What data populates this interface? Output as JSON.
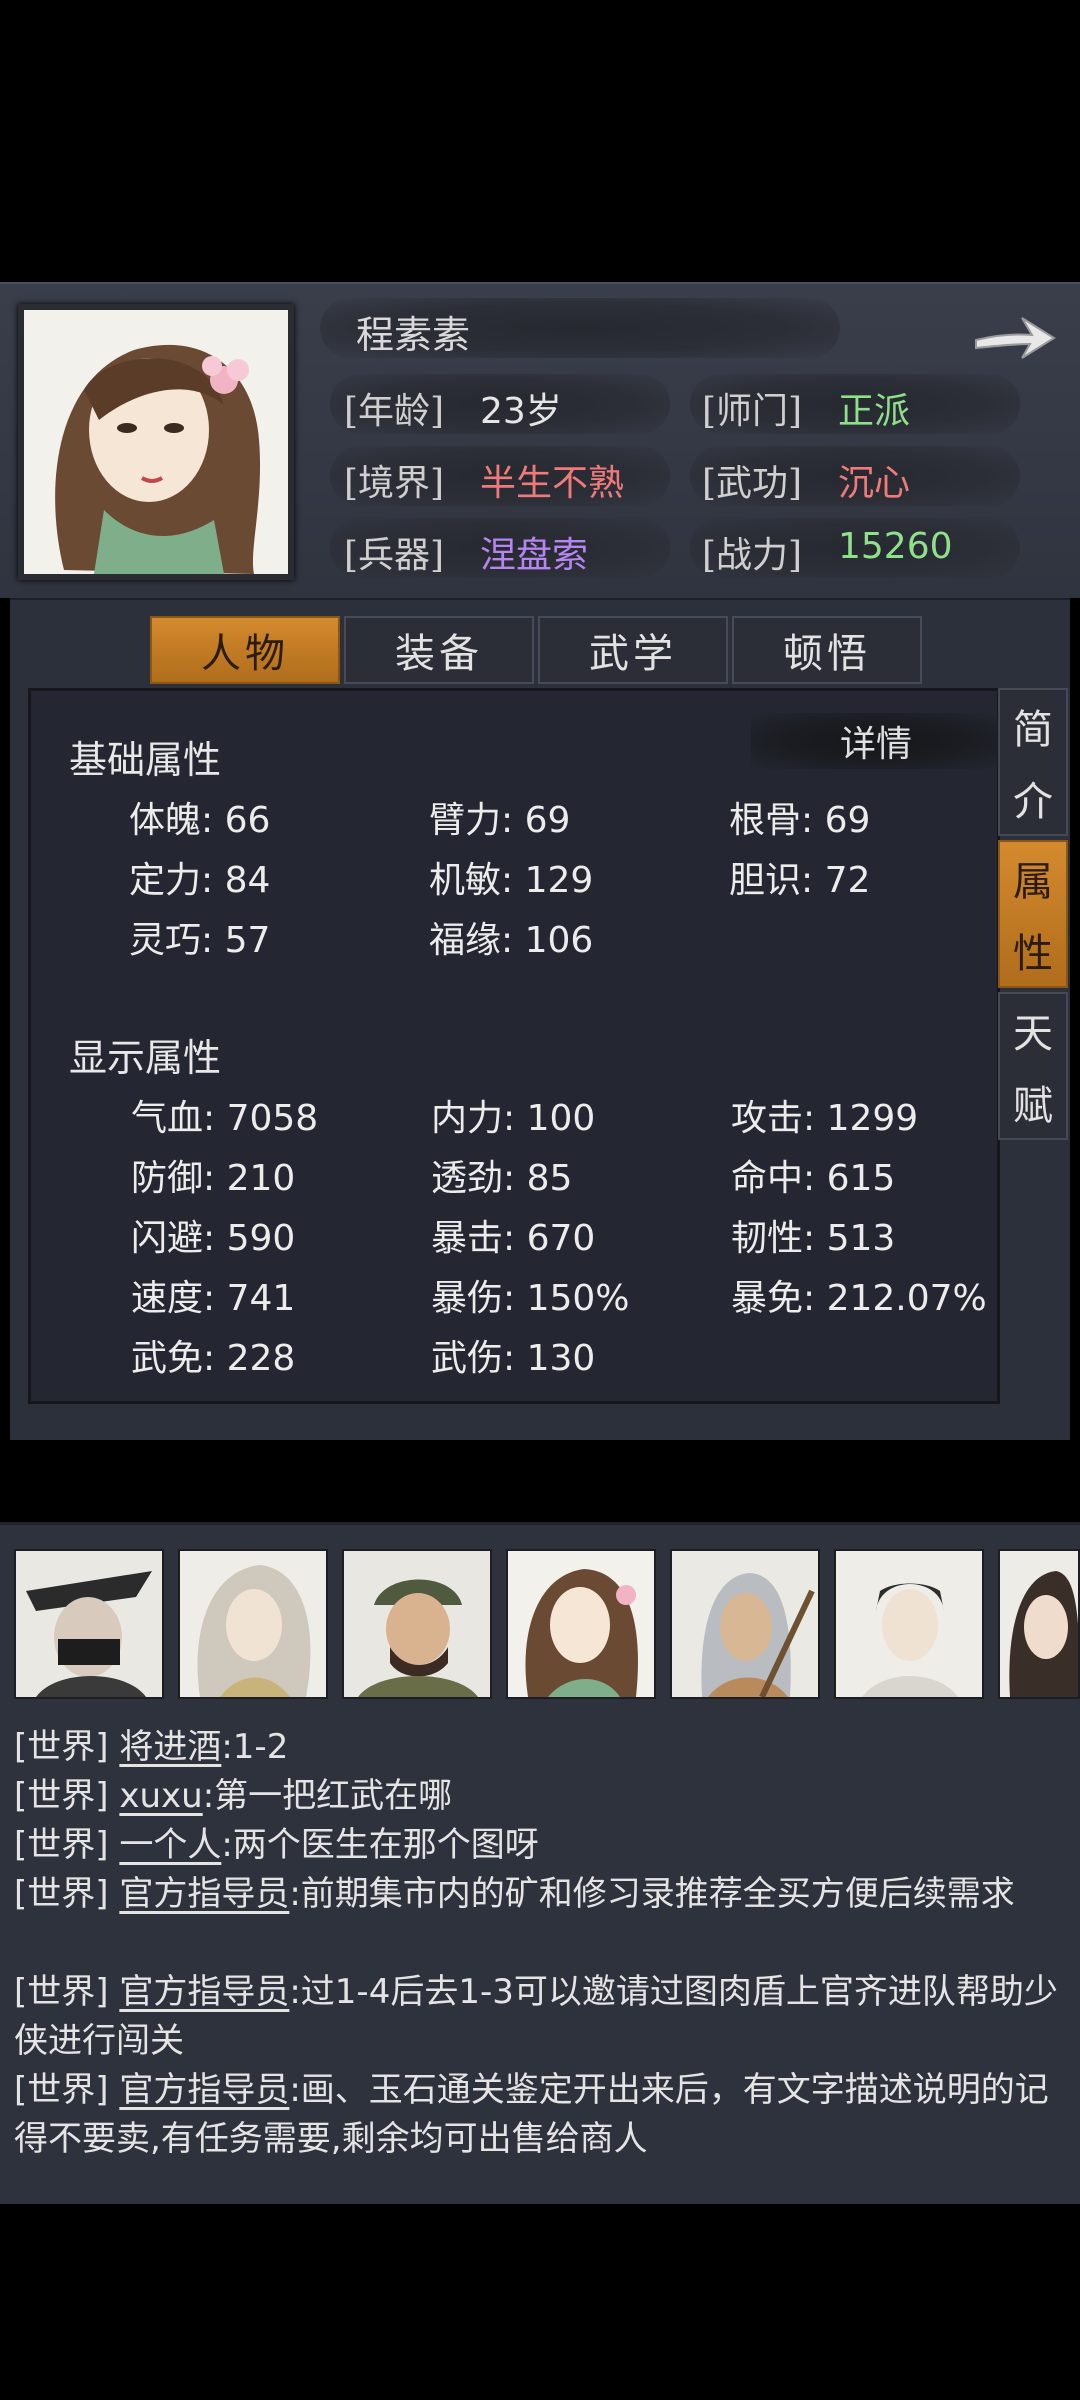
{
  "character": {
    "name": "程素素",
    "rows": [
      {
        "key": "[年龄]",
        "value": "23岁",
        "color": "#e6e6e6"
      },
      {
        "key": "[师门]",
        "value": "正派",
        "color": "#8fe08a"
      },
      {
        "key": "[境界]",
        "value": "半生不熟",
        "color": "#f07a7a"
      },
      {
        "key": "[武功]",
        "value": "沉心",
        "color": "#f07a7a"
      },
      {
        "key": "[兵器]",
        "value": "涅盘索",
        "color": "#b585f0"
      },
      {
        "key": "[战力]",
        "value": "15260",
        "color": "#8fe08a"
      }
    ]
  },
  "tabs": [
    "人物",
    "装备",
    "武学",
    "顿悟"
  ],
  "side_tabs": [
    {
      "label": "简介",
      "chars": [
        "简",
        "介"
      ]
    },
    {
      "label": "属性",
      "chars": [
        "属",
        "性"
      ]
    },
    {
      "label": "天赋",
      "chars": [
        "天",
        "赋"
      ]
    }
  ],
  "details_label": "详情",
  "basic": {
    "title": "基础属性",
    "stats": [
      "体魄: 66",
      "臂力: 69",
      "根骨: 69",
      "定力: 84",
      "机敏: 129",
      "胆识: 72",
      "灵巧: 57",
      "福缘: 106"
    ]
  },
  "display": {
    "title": "显示属性",
    "stats": [
      "气血: 7058",
      "内力: 100",
      "攻击: 1299",
      "防御: 210",
      "透劲: 85",
      "命中: 615",
      "闪避: 590",
      "暴击: 670",
      "韧性: 513",
      "速度: 741",
      "暴伤: 150%",
      "暴免: 212.07%",
      "武免: 228",
      "武伤: 130"
    ]
  },
  "chat": {
    "messages": [
      {
        "channel": "[世界]",
        "user": "将进酒",
        "text": ":1-2"
      },
      {
        "channel": "[世界]",
        "user": "xuxu",
        "text": ":第一把红武在哪"
      },
      {
        "channel": "[世界]",
        "user": "一个人",
        "text": ":两个医生在那个图呀"
      },
      {
        "channel": "[世界]",
        "user": "官方指导员",
        "text": ":前期集市内的矿和修习录推荐全买方便后续需求"
      },
      {
        "channel": "[世界]",
        "user": "官方指导员",
        "text": ":过1-4后去1-3可以邀请过图肉盾上官齐进队帮助少侠进行闯关"
      },
      {
        "channel": "[世界]",
        "user": "官方指导员",
        "text": ":画、玉石通关鉴定开出来后，有文字描述说明的记得不要卖,有任务需要,剩余均可出售给商人"
      }
    ]
  }
}
